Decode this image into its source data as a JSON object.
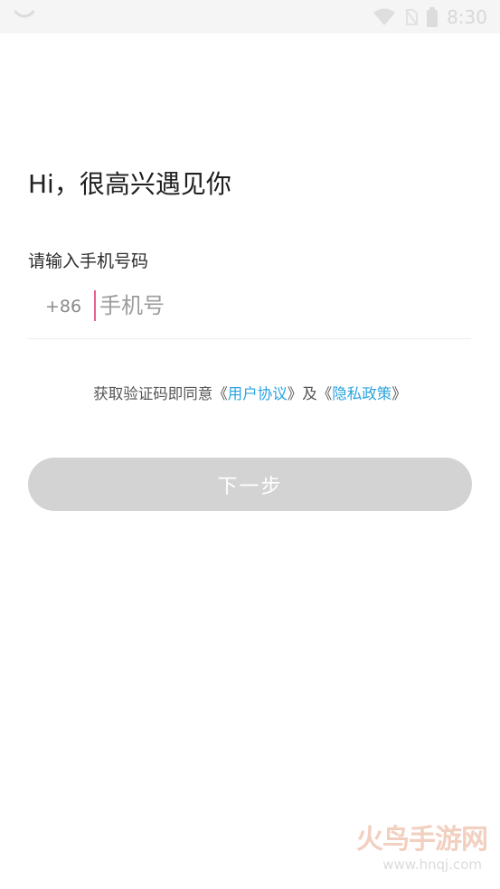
{
  "status_bar": {
    "time": "8:30",
    "icons": [
      "notification-icon",
      "wifi-icon",
      "no-sim-icon",
      "battery-icon"
    ]
  },
  "greeting": "Hi，很高兴遇见你",
  "phone": {
    "label": "请输入手机号码",
    "country_code": "+86",
    "placeholder": "手机号",
    "value": ""
  },
  "agreement": {
    "prefix": "获取验证码即同意《",
    "user_agreement": "用户协议",
    "middle": "》及《",
    "privacy_policy": "隐私政策",
    "suffix": "》",
    "link_color": "#2ba4e0"
  },
  "next_button": {
    "label": "下一步",
    "background": "#d3d3d3"
  },
  "watermark": {
    "main": "火鸟手游网",
    "sub": "www.hnqj.com"
  },
  "colors": {
    "cursor": "#ec5f8c",
    "divider": "#ededed"
  }
}
